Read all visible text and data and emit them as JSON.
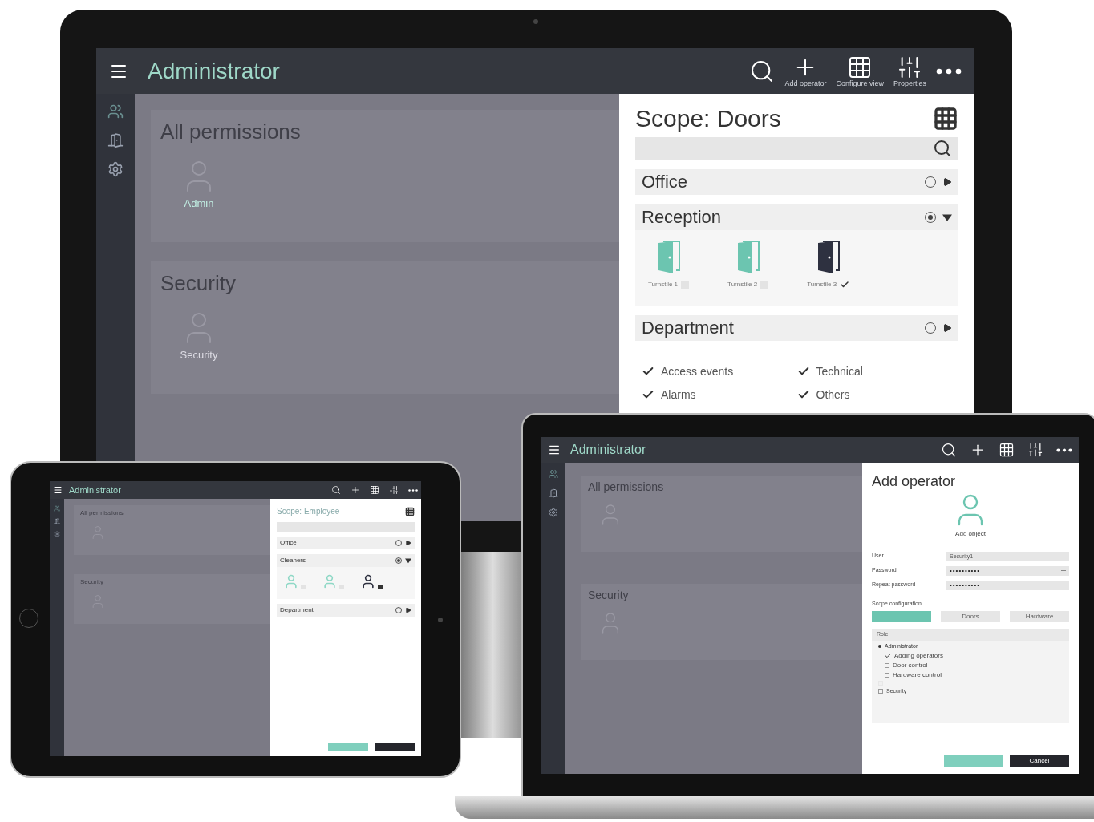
{
  "monitor": {
    "app_title": "Administrator",
    "toolbar": [
      {
        "kind": "search"
      },
      {
        "kind": "add",
        "label": "Add operator"
      },
      {
        "kind": "grid",
        "label": "Configure view"
      },
      {
        "kind": "sliders",
        "label": "Properties"
      },
      {
        "kind": "more"
      }
    ],
    "groups": [
      {
        "title": "All permissions",
        "members": [
          {
            "name": "Admin",
            "selected": true
          }
        ]
      },
      {
        "title": "Security",
        "members": [
          {
            "name": "Security",
            "selected": false
          }
        ]
      }
    ],
    "panel": {
      "title": "Scope: Doors",
      "sections": [
        {
          "name": "Office",
          "selected": false,
          "expanded": false
        },
        {
          "name": "Reception",
          "selected": true,
          "expanded": true,
          "doors": [
            {
              "name": "Turnstile 1",
              "checked": false
            },
            {
              "name": "Turnstile 2",
              "checked": false
            },
            {
              "name": "Turnstile 3",
              "checked": true
            }
          ]
        },
        {
          "name": "Department",
          "selected": false,
          "expanded": false
        }
      ],
      "filters": [
        {
          "label": "Access events",
          "checked": true
        },
        {
          "label": "Technical",
          "checked": true
        },
        {
          "label": "Alarms",
          "checked": true
        },
        {
          "label": "Others",
          "checked": true
        }
      ]
    }
  },
  "tablet": {
    "app_title": "Administrator",
    "toolbar": [
      {
        "kind": "search"
      },
      {
        "kind": "add"
      },
      {
        "kind": "grid"
      },
      {
        "kind": "sliders"
      },
      {
        "kind": "more"
      }
    ],
    "groups": [
      {
        "title": "All permissions"
      },
      {
        "title": "Security"
      }
    ],
    "panel": {
      "title": "Scope: Employee",
      "sections": [
        {
          "name": "Office",
          "selected": false,
          "expanded": false
        },
        {
          "name": "Cleaners",
          "selected": true,
          "expanded": true,
          "people": [
            {
              "checked": false
            },
            {
              "checked": false
            },
            {
              "checked": true
            }
          ]
        },
        {
          "name": "Department",
          "selected": false,
          "expanded": false
        }
      ],
      "buttons": [
        {
          "kind": "primary"
        },
        {
          "kind": "secondary"
        }
      ]
    }
  },
  "laptop": {
    "app_title": "Administrator",
    "toolbar": [
      {
        "kind": "search"
      },
      {
        "kind": "add"
      },
      {
        "kind": "grid"
      },
      {
        "kind": "sliders"
      },
      {
        "kind": "more"
      }
    ],
    "groups": [
      {
        "title": "All permissions"
      },
      {
        "title": "Security"
      }
    ],
    "form": {
      "title": "Add operator",
      "avatar_caption": "Add object",
      "fields": [
        {
          "label": "User",
          "value": "Security1",
          "kind": "text"
        },
        {
          "label": "Password",
          "value": "••••••••••",
          "kind": "password"
        },
        {
          "label": "Repeat password",
          "value": "••••••••••",
          "kind": "password"
        }
      ],
      "scope_label": "Scope configuration",
      "scope_buttons": [
        {
          "selected": true
        },
        {
          "label": "Doors",
          "selected": false
        },
        {
          "label": "Hardware",
          "selected": false
        }
      ],
      "role_label": "Role",
      "roles": [
        {
          "label": "Administrator",
          "expanded": true,
          "children": [
            {
              "label": "Adding operators",
              "checked": true
            },
            {
              "label": "Door control",
              "checked": false
            },
            {
              "label": "Hardware control",
              "checked": false
            }
          ]
        },
        {
          "checked": false,
          "disabled": true
        },
        {
          "label": "Security",
          "checked": false,
          "disabled": false
        }
      ],
      "buttons": [
        {
          "kind": "primary"
        },
        {
          "kind": "secondary",
          "label": "Cancel"
        }
      ]
    }
  }
}
